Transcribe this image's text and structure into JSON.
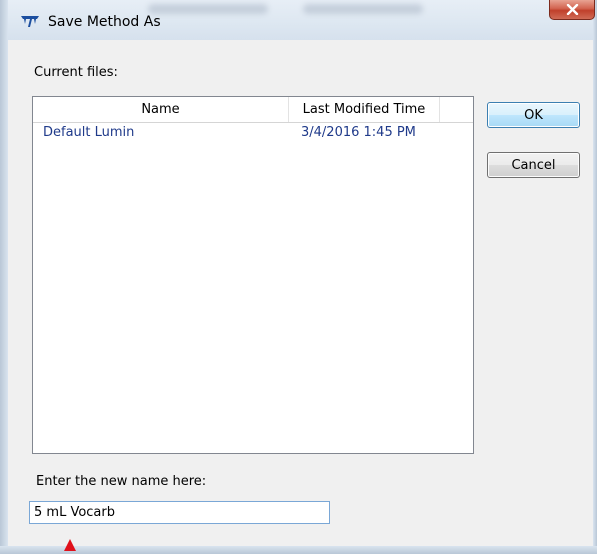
{
  "window": {
    "title": "Save Method As",
    "close_glyph": "X"
  },
  "dialog": {
    "current_files_label": "Current files:",
    "columns": [
      "Name",
      "Last Modified Time"
    ],
    "files": [
      {
        "name": "Default Lumin",
        "modified": "3/4/2016 1:45 PM"
      }
    ],
    "ok_label": "OK",
    "cancel_label": "Cancel",
    "new_name_label": "Enter the new name here:",
    "new_name_value": "5 mL Vocarb"
  },
  "icons": {
    "app": "teledyne-logo-icon",
    "close": "close-icon",
    "pointer": "red-arrow-icon"
  },
  "colors": {
    "file_text": "#1f3a8a",
    "close_button": "#c7452f",
    "ok_border": "#3c7fb1",
    "arrow": "#e0101a"
  }
}
